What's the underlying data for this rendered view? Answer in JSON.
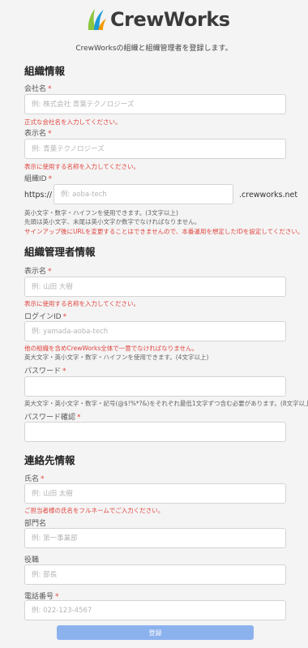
{
  "header": {
    "logo_text": "CrewWorks",
    "intro": "CrewWorksの組織と組織管理者を登録します。"
  },
  "organization": {
    "heading": "組織情報",
    "company_name": {
      "label": "会社名",
      "required_mark": "*",
      "placeholder": "例: 株式会社 青葉テクノロジーズ",
      "error": "正式な会社名を入力してください。"
    },
    "display_name": {
      "label": "表示名",
      "required_mark": "*",
      "placeholder": "例: 青葉テクノロジーズ",
      "error": "表示に使用する名称を入力してください。"
    },
    "org_id": {
      "label": "組織ID",
      "required_mark": "*",
      "prefix": "https://",
      "placeholder": "例: aoba-tech",
      "suffix": ".crewworks.net",
      "hint1": "英小文字・数字・ハイフンを使用できます。(3文字以上)",
      "hint2": "先頭は英小文字、末尾は英小文字か数字でなければなりません。",
      "error": "サインアップ後にURLを変更することはできませんので、本番運用を想定したIDを設定してください。"
    }
  },
  "admin": {
    "heading": "組織管理者情報",
    "display_name": {
      "label": "表示名",
      "required_mark": "*",
      "placeholder": "例: 山田 大樹",
      "error": "表示に使用する名称を入力してください。"
    },
    "login_id": {
      "label": "ログインID",
      "required_mark": "*",
      "placeholder": "例: yamada-aoba-tech",
      "error": "他の組織を含めCrewWorks全体で一意でなければなりません。",
      "hint": "英大文字・英小文字・数字・ハイフンを使用できます。(4文字以上)"
    },
    "password": {
      "label": "パスワード",
      "required_mark": "*",
      "placeholder": "",
      "hint": "英大文字・英小文字・数字・記号(@$!%*?&)をそれぞれ最低1文字ずつ含む必要があります。(8文字以上)"
    },
    "password_confirm": {
      "label": "パスワード確認",
      "required_mark": "*",
      "placeholder": ""
    }
  },
  "contact": {
    "heading": "連絡先情報",
    "full_name": {
      "label": "氏名",
      "required_mark": "*",
      "placeholder": "例: 山田 太樹",
      "error": "ご担当者様の氏名をフルネームでご入力ください。"
    },
    "department": {
      "label": "部門名",
      "placeholder": "例: 第一事業部"
    },
    "position": {
      "label": "役職",
      "placeholder": "例: 部長"
    },
    "phone": {
      "label": "電話番号",
      "required_mark": "*",
      "placeholder": "例: 022-123-4567"
    }
  },
  "submit_label": "登録",
  "colors": {
    "error": "#e0443e",
    "submit": "#8cb2ee",
    "logo_green": "#8cc63f",
    "logo_blue": "#1e9bd7",
    "logo_orange": "#f39800"
  }
}
